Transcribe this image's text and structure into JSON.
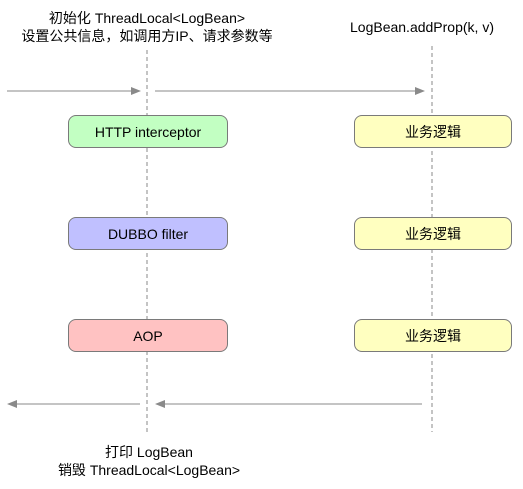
{
  "top_left_label": {
    "line1": "初始化 ThreadLocal<LogBean>",
    "line2": "设置公共信息，如调用方IP、请求参数等"
  },
  "top_right_label": "LogBean.addProp(k, v)",
  "bottom_label": {
    "line1": "打印 LogBean",
    "line2": "销毁 ThreadLocal<LogBean>"
  },
  "left_boxes": [
    {
      "label": "HTTP interceptor",
      "color": "#c2ffc2"
    },
    {
      "label": "DUBBO filter",
      "color": "#c0c0ff"
    },
    {
      "label": "AOP",
      "color": "#ffc2c2"
    }
  ],
  "right_boxes": [
    {
      "label": "业务逻辑",
      "color": "#ffffc0"
    },
    {
      "label": "业务逻辑",
      "color": "#ffffc0"
    },
    {
      "label": "业务逻辑",
      "color": "#ffffc0"
    }
  ],
  "colors": {
    "line": "#8a8a8a",
    "box_border": "#7a7a7a"
  }
}
